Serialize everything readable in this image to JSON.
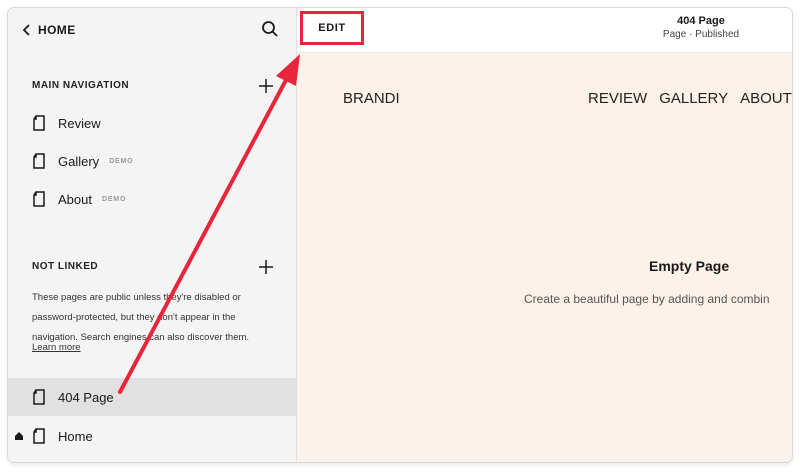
{
  "sidebar": {
    "back_label": "HOME",
    "main_navigation": {
      "title": "MAIN NAVIGATION",
      "items": [
        {
          "label": "Review",
          "badge": ""
        },
        {
          "label": "Gallery",
          "badge": "DEMO"
        },
        {
          "label": "About",
          "badge": "DEMO"
        }
      ]
    },
    "not_linked": {
      "title": "NOT LINKED",
      "description": "These pages are public unless they're disabled or password-protected, but they don't appear in the navigation. Search engines can also discover them.",
      "learn_more": "Learn more",
      "items": [
        {
          "label": "404 Page"
        },
        {
          "label": "Home"
        }
      ]
    }
  },
  "topbar": {
    "edit_label": "EDIT",
    "page_title": "404 Page",
    "page_status": "Page · Published"
  },
  "preview": {
    "brand": "BRANDI",
    "nav": [
      "REVIEW",
      "GALLERY",
      "ABOUT"
    ],
    "empty_title": "Empty Page",
    "empty_subtitle": "Create a beautiful page by adding and combin"
  },
  "colors": {
    "highlight_red": "#e8253a",
    "preview_bg": "#fdf2ea",
    "sidebar_bg": "#f4f4f4",
    "selected_row": "#e1e1e1"
  },
  "icons": [
    "chevron-left-icon",
    "search-icon",
    "plus-icon",
    "page-icon",
    "home-icon"
  ]
}
